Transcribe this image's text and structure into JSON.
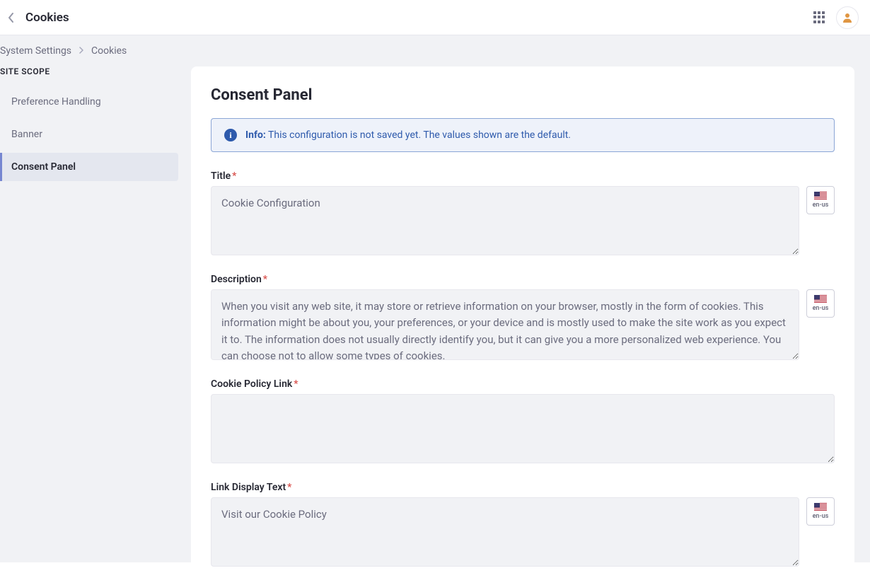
{
  "header": {
    "title": "Cookies"
  },
  "breadcrumb": {
    "parent": "System Settings",
    "current": "Cookies"
  },
  "sidebar": {
    "heading": "SITE SCOPE",
    "items": [
      {
        "label": "Preference Handling",
        "active": false
      },
      {
        "label": "Banner",
        "active": false
      },
      {
        "label": "Consent Panel",
        "active": true
      }
    ]
  },
  "main": {
    "title": "Consent Panel",
    "info": {
      "prefix": "Info:",
      "message": "This configuration is not saved yet. The values shown are the default."
    },
    "fields": {
      "title": {
        "label": "Title",
        "placeholder": "Cookie Configuration",
        "lang": "en-us"
      },
      "description": {
        "label": "Description",
        "placeholder": "When you visit any web site, it may store or retrieve information on your browser, mostly in the form of cookies. This information might be about you, your preferences, or your device and is mostly used to make the site work as you expect it to. The information does not usually directly identify you, but it can give you a more personalized web experience. You can choose not to allow some types of cookies.",
        "lang": "en-us"
      },
      "cookiePolicyLink": {
        "label": "Cookie Policy Link",
        "placeholder": ""
      },
      "linkDisplayText": {
        "label": "Link Display Text",
        "placeholder": "Visit our Cookie Policy",
        "lang": "en-us"
      }
    }
  }
}
